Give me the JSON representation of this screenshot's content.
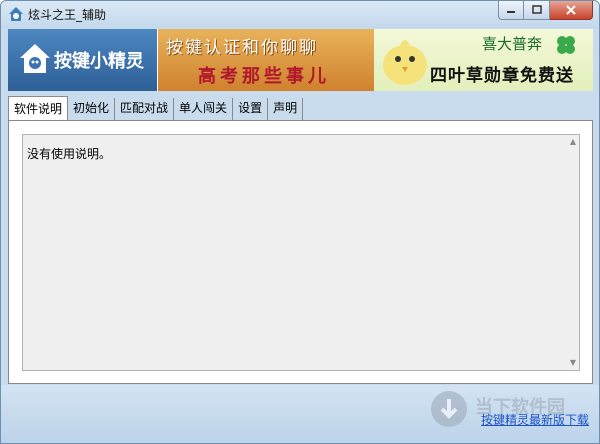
{
  "window": {
    "title": "炫斗之王_辅助",
    "controls": {
      "minimize": "minimize-icon",
      "maximize": "maximize-icon",
      "close": "close-icon"
    }
  },
  "banner": {
    "logo_text": "按键小精灵",
    "ad1": {
      "line1": "按键认证和你聊聊",
      "line2": "高考那些事儿"
    },
    "ad2": {
      "line1": "喜大普奔",
      "line2": "四叶草勋章免费送"
    }
  },
  "tabs": [
    {
      "label": "软件说明",
      "active": true
    },
    {
      "label": "初始化",
      "active": false
    },
    {
      "label": "匹配对战",
      "active": false
    },
    {
      "label": "单人闯关",
      "active": false
    },
    {
      "label": "设置",
      "active": false
    },
    {
      "label": "声明",
      "active": false
    }
  ],
  "content": {
    "text": "没有使用说明。"
  },
  "footer": {
    "link": "按键精灵最新版下载",
    "watermark": "当下软件园"
  },
  "colors": {
    "accent": "#2d5f98",
    "link": "#1a52c9"
  }
}
